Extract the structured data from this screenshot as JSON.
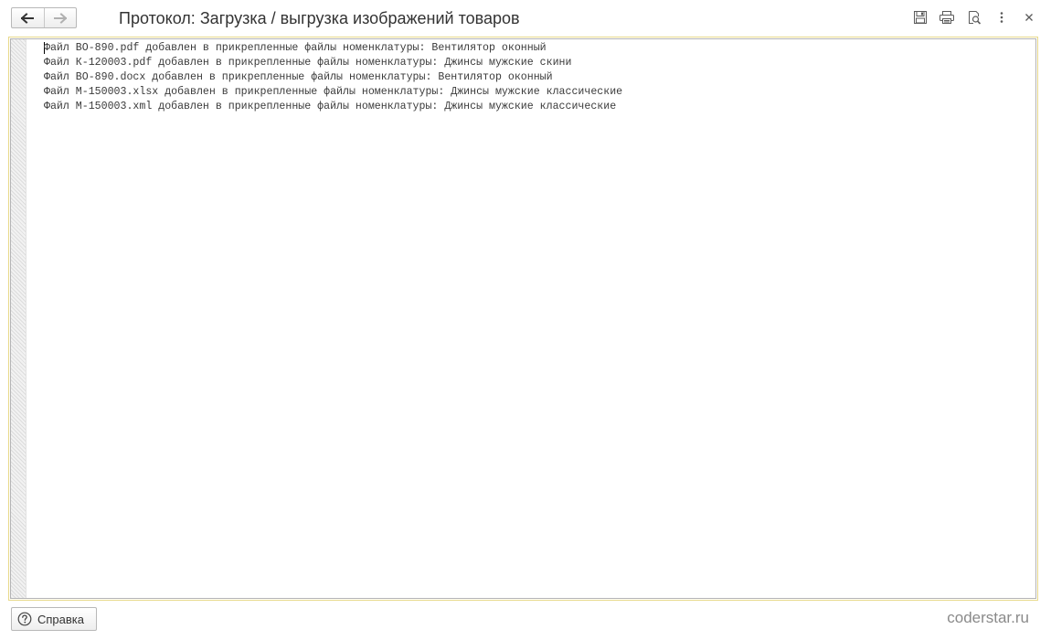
{
  "header": {
    "title": "Протокол: Загрузка / выгрузка изображений товаров",
    "nav": {
      "back_icon": "arrow-left-icon",
      "forward_icon": "arrow-right-icon"
    },
    "toolbar_icons": [
      "save-icon",
      "print-icon",
      "preview-icon",
      "more-icon",
      "close-icon"
    ]
  },
  "document": {
    "lines": [
      "Файл ВО-890.pdf добавлен в прикрепленные файлы номенклатуры: Вентилятор оконный",
      "Файл К-120003.pdf добавлен в прикрепленные файлы номенклатуры: Джинсы мужские скини",
      "Файл ВО-890.docx добавлен в прикрепленные файлы номенклатуры: Вентилятор оконный",
      "Файл М-150003.xlsx добавлен в прикрепленные файлы номенклатуры: Джинсы мужские классические",
      "Файл М-150003.xml добавлен в прикрепленные файлы номенклатуры: Джинсы мужские классические"
    ]
  },
  "footer": {
    "help_label": "Справка",
    "help_icon": "help-circle-icon",
    "watermark": "coderstar.ru"
  },
  "colors": {
    "frame_border": "#e8d98a",
    "text": "#3a3a3a",
    "title_text": "#333333",
    "watermark": "#8a8a8a"
  }
}
